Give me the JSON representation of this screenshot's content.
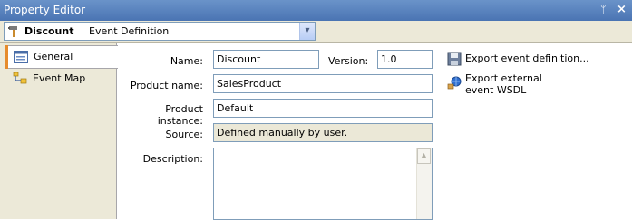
{
  "window": {
    "title": "Property Editor",
    "pin_glyph": "ᛘ",
    "close_glyph": "×"
  },
  "toolbar": {
    "object_name": "Discount",
    "object_type": "Event Definition",
    "dropdown_glyph": "▾",
    "icon": "hammer-icon"
  },
  "tabs": [
    {
      "label": "General",
      "icon": "form-icon",
      "active": true
    },
    {
      "label": "Event Map",
      "icon": "map-icon",
      "active": false
    }
  ],
  "form": {
    "name_label": "Name:",
    "name_value": "Discount",
    "version_label": "Version:",
    "version_value": "1.0",
    "product_name_label": "Product name:",
    "product_name_value": "SalesProduct",
    "product_instance_label": "Product instance:",
    "product_instance_value": "Default",
    "source_label": "Source:",
    "source_value": "Defined manually by user.",
    "description_label": "Description:",
    "description_value": ""
  },
  "actions": {
    "export_definition": "Export event definition...",
    "export_wsdl_line1": "Export external",
    "export_wsdl_line2": "event WSDL"
  },
  "colors": {
    "title_bar": "#4a74b3",
    "panel": "#ece9d8",
    "field_border": "#7f9db9",
    "tab_accent": "#e68b2c"
  }
}
